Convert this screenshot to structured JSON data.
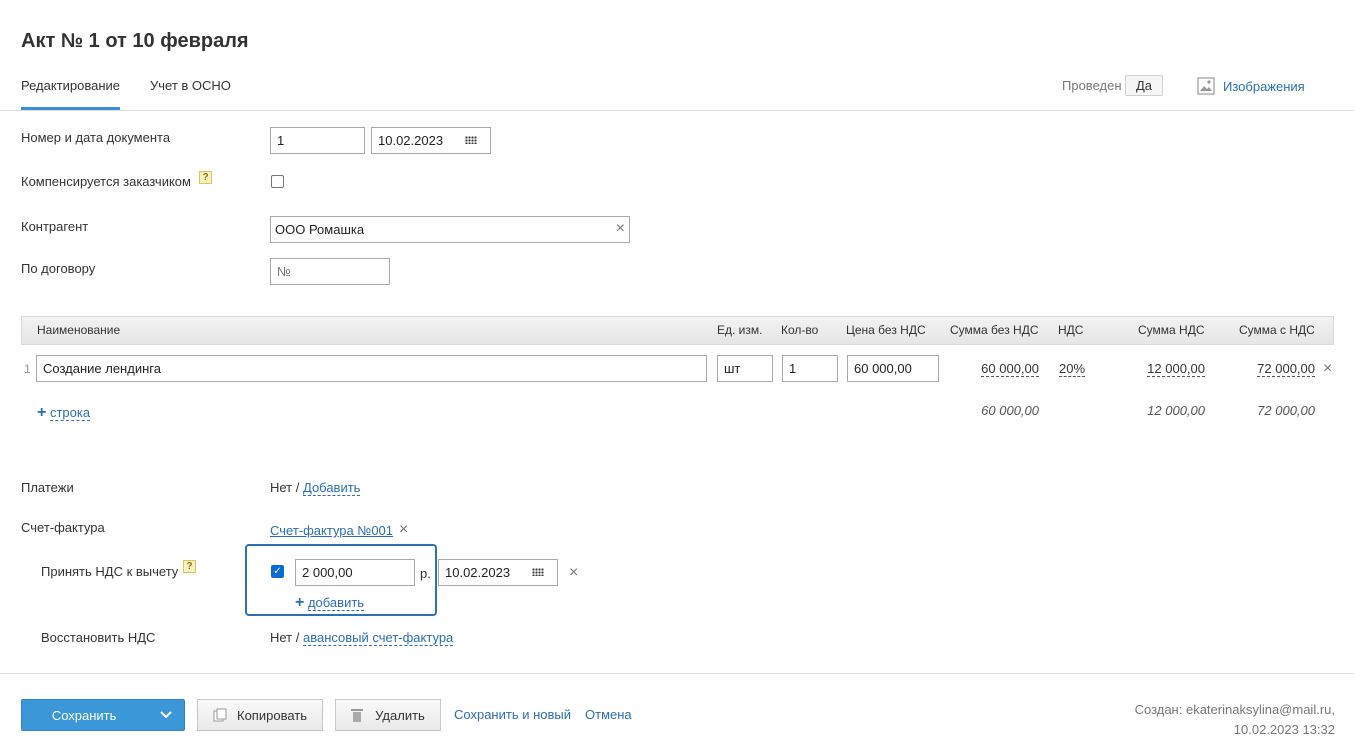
{
  "page": {
    "title": "Акт № 1 от 10 февраля"
  },
  "tabs": {
    "editing": "Редактирование",
    "osno": "Учет в ОСНО"
  },
  "status": {
    "label": "Проведен",
    "value": "Да",
    "images_link": "Изображения"
  },
  "form": {
    "doc_number_label": "Номер и дата документа",
    "doc_number": "1",
    "doc_date": "10.02.2023",
    "compensated_label": "Компенсируется заказчиком",
    "help_mark": "?",
    "contractor_label": "Контрагент",
    "contractor_value": "ООО Ромашка",
    "contract_label": "По договору",
    "contract_placeholder": "№"
  },
  "table": {
    "headers": {
      "name": "Наименование",
      "unit": "Ед. изм.",
      "qty": "Кол-во",
      "price": "Цена без НДС",
      "sum_no_vat": "Сумма без НДС",
      "vat": "НДС",
      "vat_sum": "Сумма НДС",
      "sum_with_vat": "Сумма с НДС"
    },
    "rows": [
      {
        "index": "1",
        "name": "Создание лендинга",
        "unit": "шт",
        "qty": "1",
        "price": "60 000,00",
        "sum_no_vat": "60 000,00",
        "vat": "20%",
        "vat_sum": "12 000,00",
        "sum_with_vat": "72 000,00"
      }
    ],
    "add_row": "строка",
    "totals": {
      "sum_no_vat": "60 000,00",
      "vat_sum": "12 000,00",
      "sum_with_vat": "72 000,00"
    }
  },
  "payments": {
    "label": "Платежи",
    "value": "Нет /",
    "add_link": "Добавить"
  },
  "invoice": {
    "label": "Счет-фактура",
    "link": "Счет-фактура №001"
  },
  "vat_deduction": {
    "label": "Принять НДС к вычету",
    "amount": "2 000,00",
    "currency": "р.",
    "date": "10.02.2023",
    "add_link": "добавить"
  },
  "vat_restore": {
    "label": "Восстановить НДС",
    "value": "Нет /",
    "link": "авансовый счет-фактура"
  },
  "footer": {
    "save": "Сохранить",
    "copy": "Копировать",
    "delete": "Удалить",
    "save_and_new": "Сохранить и новый",
    "cancel": "Отмена",
    "created_by": "Создан: ekaterinaksylina@mail.ru,",
    "created_at": "10.02.2023 13:32"
  },
  "colors": {
    "accent": "#3b97d8",
    "link": "#2a6db3",
    "focus_border": "#2f6fb0"
  }
}
